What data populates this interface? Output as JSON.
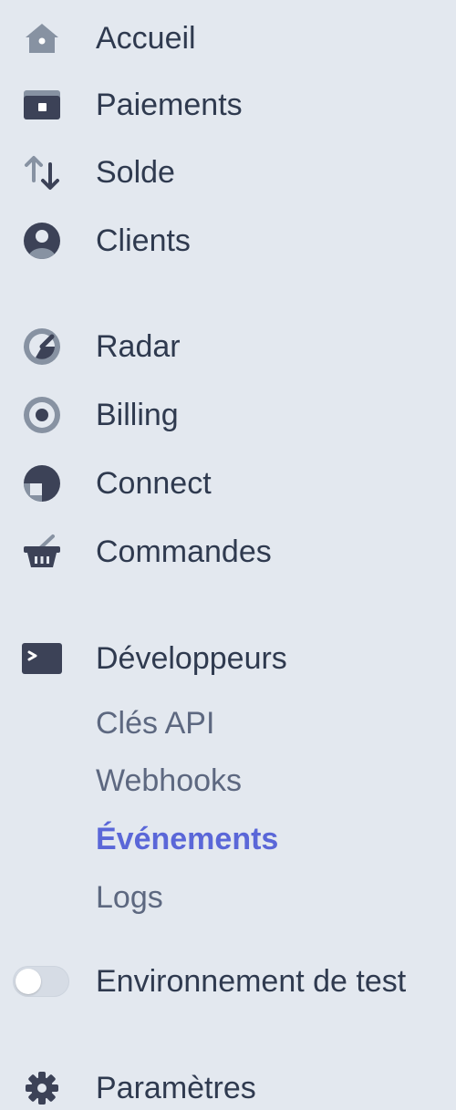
{
  "nav": {
    "home": {
      "label": "Accueil",
      "icon": "home-icon"
    },
    "payments": {
      "label": "Paiements",
      "icon": "wallet-icon"
    },
    "balance": {
      "label": "Solde",
      "icon": "transfer-arrows-icon"
    },
    "customers": {
      "label": "Clients",
      "icon": "user-icon"
    },
    "radar": {
      "label": "Radar",
      "icon": "radar-icon"
    },
    "billing": {
      "label": "Billing",
      "icon": "billing-icon"
    },
    "connect": {
      "label": "Connect",
      "icon": "connect-icon"
    },
    "orders": {
      "label": "Commandes",
      "icon": "basket-icon"
    },
    "developers": {
      "label": "Développeurs",
      "icon": "terminal-icon",
      "items": [
        {
          "label": "Clés API",
          "active": false
        },
        {
          "label": "Webhooks",
          "active": false
        },
        {
          "label": "Événements",
          "active": true
        },
        {
          "label": "Logs",
          "active": false
        }
      ]
    },
    "test_mode": {
      "label": "Environnement de test",
      "enabled": false
    },
    "settings": {
      "label": "Paramètres",
      "icon": "gear-icon"
    }
  },
  "colors": {
    "background": "#e3e8ef",
    "text": "#2f3a4f",
    "subtext": "#5d6880",
    "active": "#5a67d8",
    "icon": "#8792a2",
    "icon_dark": "#3c4257"
  }
}
